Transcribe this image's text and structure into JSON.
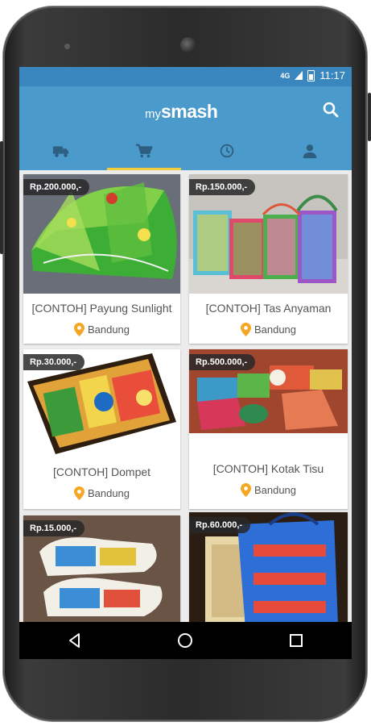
{
  "status_bar": {
    "network": "4G",
    "time": "11:17"
  },
  "app": {
    "logo_prefix": "my",
    "logo_brand": "smash"
  },
  "tabs": [
    {
      "name": "delivery",
      "icon": "truck-icon"
    },
    {
      "name": "shop",
      "icon": "cart-icon",
      "active": true
    },
    {
      "name": "history",
      "icon": "clock-icon"
    },
    {
      "name": "profile",
      "icon": "person-icon"
    }
  ],
  "products": [
    {
      "price": "Rp.200.000,-",
      "title": "[CONTOH] Payung Sunlight",
      "location": "Bandung"
    },
    {
      "price": "Rp.150.000,-",
      "title": "[CONTOH] Tas Anyaman",
      "location": "Bandung"
    },
    {
      "price": "Rp.30.000,-",
      "title": "[CONTOH] Dompet",
      "location": "Bandung"
    },
    {
      "price": "Rp.500.000,-",
      "title": "[CONTOH] Kotak Tisu",
      "location": "Bandung"
    },
    {
      "price": "Rp.15.000,-",
      "title": "",
      "location": ""
    },
    {
      "price": "Rp.60.000,-",
      "title": "",
      "location": ""
    }
  ],
  "colors": {
    "primary": "#4a9acc",
    "status": "#3a86bf",
    "accent": "#f2cc3a",
    "pin": "#f5a623"
  }
}
